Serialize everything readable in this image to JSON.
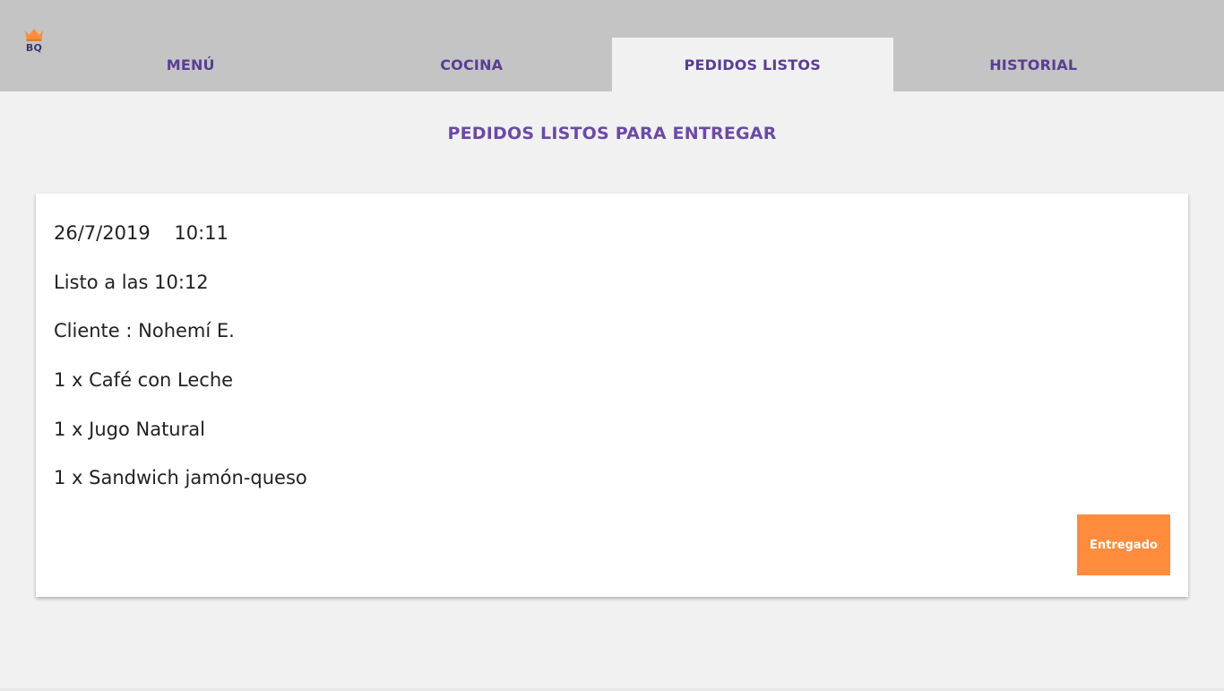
{
  "brand": {
    "logo_text": "BQ",
    "icon": "crown-icon",
    "icon_color": "#ff8c3c",
    "text_color": "#3d3470"
  },
  "nav": {
    "tabs": [
      {
        "label": "MENÚ",
        "active": false
      },
      {
        "label": "COCINA",
        "active": false
      },
      {
        "label": "PEDIDOS LISTOS",
        "active": true
      },
      {
        "label": "HISTORIAL",
        "active": false
      }
    ],
    "color": "#5a3d94"
  },
  "main": {
    "title": "PEDIDOS LISTOS PARA ENTREGAR",
    "title_color": "#6b4aa6"
  },
  "order": {
    "date": "26/7/2019",
    "time": "10:11",
    "ready_text": "Listo a las 10:12",
    "client_text": "Cliente : Nohemí E.",
    "items": [
      "1 x Café con Leche",
      "1 x Jugo Natural",
      "1 x Sandwich jamón-queso"
    ],
    "deliver_label": "Entregado",
    "deliver_color": "#ff8c3c"
  }
}
